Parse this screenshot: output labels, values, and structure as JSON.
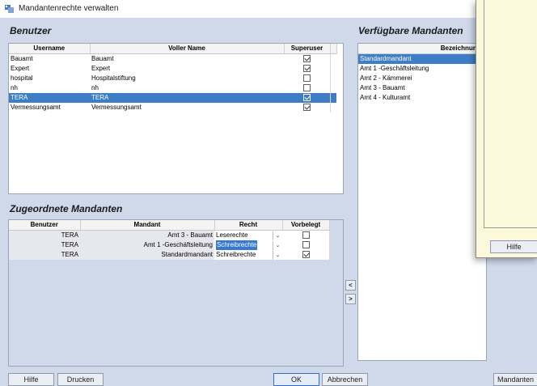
{
  "window": {
    "title": "Mandantenrechte verwalten"
  },
  "benutzer": {
    "title": "Benutzer",
    "columns": [
      "Username",
      "Voller Name",
      "Superuser"
    ],
    "rows": [
      {
        "username": "Bauamt",
        "fullname": "Bauamt",
        "superuser": true,
        "selected": false
      },
      {
        "username": "Expert",
        "fullname": "Expert",
        "superuser": true,
        "selected": false
      },
      {
        "username": "hospital",
        "fullname": "Hospitalstiftung",
        "superuser": false,
        "selected": false
      },
      {
        "username": "nh",
        "fullname": "nh",
        "superuser": false,
        "selected": false
      },
      {
        "username": "TERA",
        "fullname": "TERA",
        "superuser": true,
        "selected": true
      },
      {
        "username": "Vermessungsamt",
        "fullname": "Vermessungsamt",
        "superuser": true,
        "selected": false
      }
    ]
  },
  "verfuegbar": {
    "title": "Verfügbare Mandanten",
    "column": "Bezeichnung",
    "items": [
      {
        "label": "Standardmandant",
        "selected": true
      },
      {
        "label": "Amt 1 -Geschäftsleitung",
        "selected": false
      },
      {
        "label": "Amt 2 - Kämmerei",
        "selected": false
      },
      {
        "label": "Amt 3 - Bauamt",
        "selected": false
      },
      {
        "label": "Amt 4 - Kulturamt",
        "selected": false
      }
    ]
  },
  "zugeordnet": {
    "title": "Zugeordnete Mandanten",
    "columns": [
      "Benutzer",
      "Mandant",
      "Recht",
      "Vorbelegt"
    ],
    "rows": [
      {
        "benutzer": "TERA",
        "mandant": "Amt 3 - Bauamt",
        "recht": "Leserechte",
        "vorbelegt": false,
        "recht_selected": false
      },
      {
        "benutzer": "TERA",
        "mandant": "Amt 1 -Geschäftsleitung",
        "recht": "Schreibrechte",
        "vorbelegt": false,
        "recht_selected": true
      },
      {
        "benutzer": "TERA",
        "mandant": "Standardmandant",
        "recht": "Schreibrechte",
        "vorbelegt": true,
        "recht_selected": false
      }
    ]
  },
  "arrows": {
    "left": "<",
    "right": ">"
  },
  "popup": {
    "hilfe_label": "Hilfe"
  },
  "footer": {
    "hilfe": "Hilfe",
    "drucken": "Drucken",
    "ok": "OK",
    "abbrechen": "Abbrechen",
    "mandanten": "Mandanten"
  },
  "colors": {
    "selection": "#3d7ec6",
    "background": "#cfd9ea",
    "popup": "#fcf8dc"
  }
}
